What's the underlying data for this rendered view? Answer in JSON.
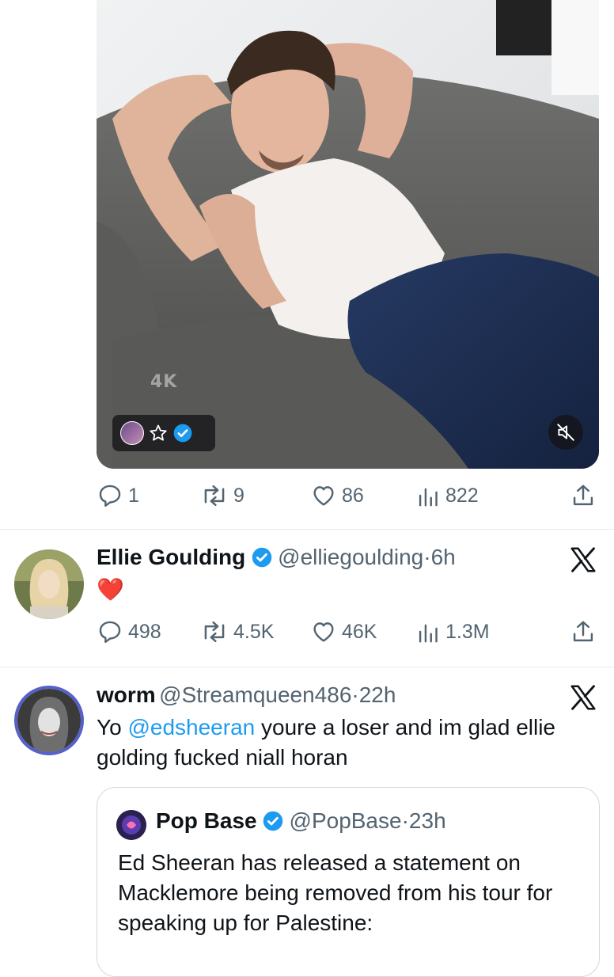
{
  "top_post": {
    "media": {
      "watermark": "4K",
      "badges": [
        "avatar",
        "star-icon",
        "verified-icon"
      ],
      "mute_icon": "muted-speaker-icon"
    },
    "actions": {
      "replies": "1",
      "reposts": "9",
      "likes": "86",
      "views": "822"
    }
  },
  "reply1": {
    "name": "Ellie Goulding",
    "handle": "@elliegoulding",
    "time": "6h",
    "text": "❤️",
    "actions": {
      "replies": "498",
      "reposts": "4.5K",
      "likes": "46K",
      "views": "1.3M"
    }
  },
  "reply2": {
    "name": "worm",
    "handle": "@Streamqueen486",
    "time": "22h",
    "text_prefix": "Yo ",
    "mention": "@edsheeran",
    "text_suffix": " youre a loser and im glad ellie golding fucked niall horan",
    "quote": {
      "name": "Pop Base",
      "handle": "@PopBase",
      "time": "23h",
      "text": "Ed Sheeran has released a statement on Macklemore being removed from his tour for speaking up for Palestine:"
    }
  },
  "colors": {
    "accent": "#1d9bf0",
    "muted": "#536471",
    "heart": "#e0245e"
  }
}
